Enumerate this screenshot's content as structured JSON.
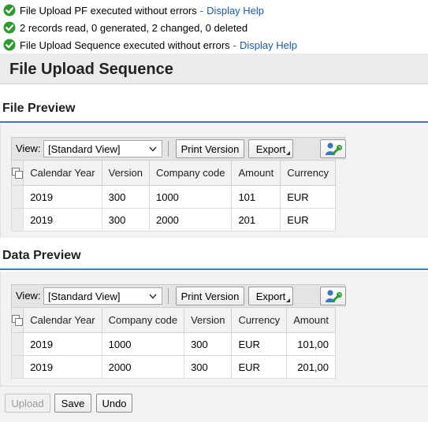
{
  "messages": [
    {
      "text": "File Upload PF executed without errors",
      "sep": "-",
      "link": "Display Help"
    },
    {
      "text": "2 records read, 0 generated, 2 changed, 0 deleted"
    },
    {
      "text": "File Upload Sequence executed without errors",
      "sep": "-",
      "link": "Display Help"
    }
  ],
  "page": {
    "title": "File Upload Sequence"
  },
  "file_preview": {
    "title": "File Preview",
    "toolbar": {
      "view_label": "View:",
      "view_value": "[Standard View]",
      "print_label": "Print Version",
      "export_label": "Export"
    },
    "columns": [
      "Calendar Year",
      "Version",
      "Company code",
      "Amount",
      "Currency"
    ],
    "rows": [
      [
        "2019",
        "300",
        "1000",
        "101",
        "EUR"
      ],
      [
        "2019",
        "300",
        "2000",
        "201",
        "EUR"
      ]
    ]
  },
  "data_preview": {
    "title": "Data Preview",
    "toolbar": {
      "view_label": "View:",
      "view_value": "[Standard View]",
      "print_label": "Print Version",
      "export_label": "Export"
    },
    "columns": [
      "Calendar Year",
      "Company code",
      "Version",
      "Currency",
      "Amount"
    ],
    "rows": [
      [
        "2019",
        "1000",
        "300",
        "EUR",
        "101,00"
      ],
      [
        "2019",
        "2000",
        "300",
        "EUR",
        "201,00"
      ]
    ]
  },
  "footer": {
    "upload_label": "Upload",
    "save_label": "Save",
    "undo_label": "Undo"
  },
  "icons": {
    "success": "check-circle-icon",
    "dropdown": "chevron-down-icon",
    "settings": "user-settings-icon",
    "select_all": "select-all-icon"
  },
  "colors": {
    "success": "#2e9b2e",
    "link": "#1a5a9a",
    "section_border": "#3f7ab5"
  }
}
